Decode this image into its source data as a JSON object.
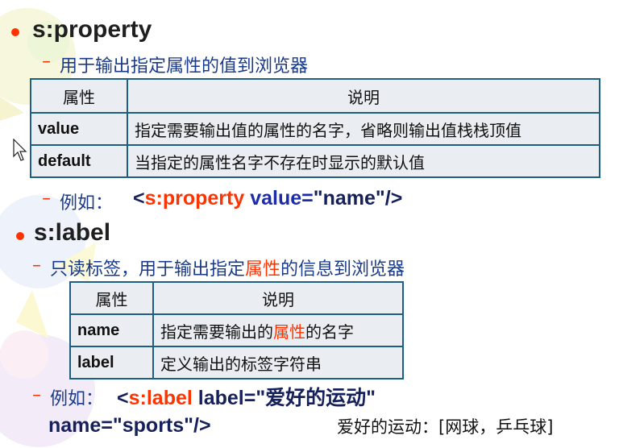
{
  "section1": {
    "title": "s:property",
    "subtitle": "用于输出指定属性的值到浏览器",
    "table": {
      "headers": [
        "属性",
        "说明"
      ],
      "rows": [
        {
          "name": "value",
          "desc": "指定需要输出值的属性的名字，省略则输出值栈栈顶值"
        },
        {
          "name": "default",
          "desc": "当指定的属性名字不存在时显示的默认值"
        }
      ]
    },
    "example": {
      "prefix": "例如：",
      "tag_open": "<",
      "tag_name": "s:property",
      "attr": " value=",
      "value": "\"name\"/>"
    }
  },
  "section2": {
    "title": "s:label",
    "subtitle_part1": "只读标签，用于输出指定",
    "subtitle_highlight": "属性",
    "subtitle_part2": "的信息到浏览器",
    "table": {
      "headers": [
        "属性",
        "说明"
      ],
      "rows": [
        {
          "name": "name",
          "desc_part1": "指定需要输出的",
          "desc_highlight": "属性",
          "desc_part2": "的名字"
        },
        {
          "name": "label",
          "desc": "定义输出的标签字符串"
        }
      ]
    },
    "example": {
      "prefix": "例如：",
      "tag_open": "<",
      "tag_name": "s:label",
      "line1_rest": " label=\"爱好的运动\"",
      "line2": "name=\"sports\"/>"
    },
    "result_note": "爱好的运动：[网球，乒乓球]"
  },
  "colors": {
    "bullet": "#ff3300",
    "heading": "#1f1f1f",
    "subtitle": "#1a3a8a",
    "highlight": "#ff3300",
    "attr_blue": "#1d2ca8",
    "table_border": "#1d5f80",
    "table_bg": "#eaeef2"
  },
  "icons": [
    "mouse-cursor-icon"
  ]
}
